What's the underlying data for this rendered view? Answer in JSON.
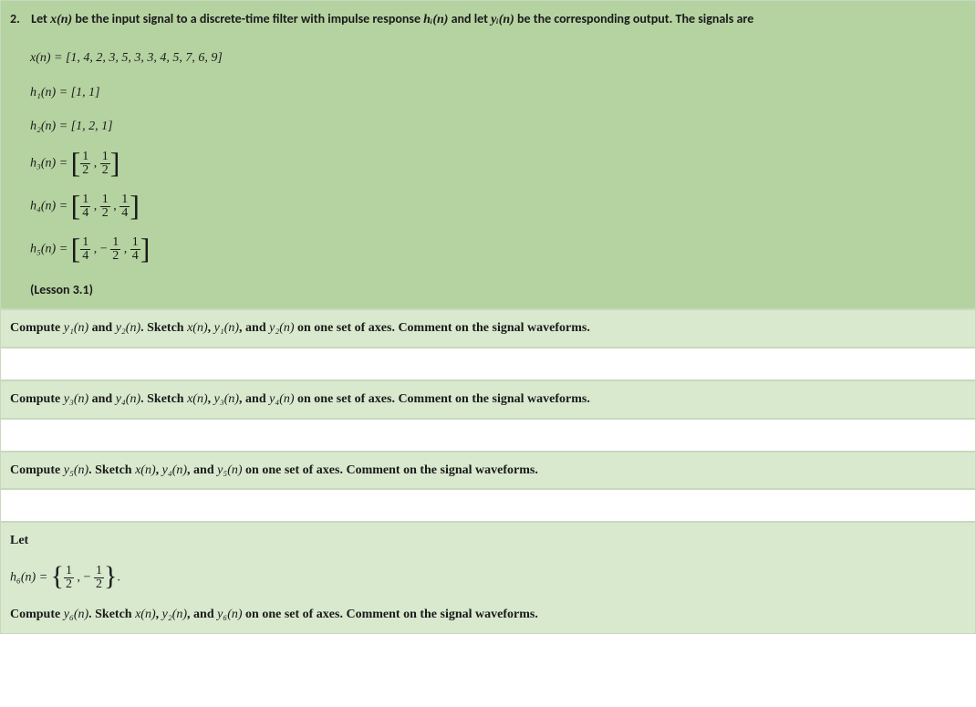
{
  "problem": {
    "number": "2.",
    "intro_part1": "Let ",
    "xn": "x(n)",
    "intro_part2": " be the input signal to a discrete-time filter with impulse response ",
    "hin": "hᵢ(n)",
    "intro_part3": " and let ",
    "yin": "yᵢ(n)",
    "intro_part4": " be the corresponding output. The signals are",
    "eq_xn": "x(n) = [1, 4, 2, 3, 5, 3, 3, 4, 5, 7, 6, 9]",
    "eq_h1": "h₁(n) = [1, 1]",
    "eq_h2": "h₂(n) = [1, 2, 1]",
    "h3_lhs": "h₃(n) = ",
    "h3_f1n": "1",
    "h3_f1d": "2",
    "h3_f2n": "1",
    "h3_f2d": "2",
    "h4_lhs": "h₄(n) = ",
    "h4_f1n": "1",
    "h4_f1d": "4",
    "h4_f2n": "1",
    "h4_f2d": "2",
    "h4_f3n": "1",
    "h4_f3d": "4",
    "h5_lhs": "h₅(n) = ",
    "h5_f1n": "1",
    "h5_f1d": "4",
    "h5_f2n": "1",
    "h5_f2d": "2",
    "h5_f3n": "1",
    "h5_f3d": "4",
    "lesson": "(Lesson 3.1)"
  },
  "row_a": {
    "p1": "Compute ",
    "y1": "y₁(n)",
    "p2": " and ",
    "y2": "y₂(n)",
    "p3": ". Sketch ",
    "x": "x(n)",
    "p4": ", ",
    "y1b": "y₁(n)",
    "p5": ", and ",
    "y2b": "y₂(n)",
    "p6": " on one set of axes. Comment on the signal waveforms."
  },
  "row_b": {
    "p1": "Compute ",
    "y3": "y₃(n)",
    "p2": " and ",
    "y4": "y₄(n)",
    "p3": ". Sketch ",
    "x": "x(n)",
    "p4": ", ",
    "y3b": "y₃(n)",
    "p5": ", and ",
    "y4b": "y₄(n)",
    "p6": " on one set of axes. Comment on the signal waveforms."
  },
  "row_c": {
    "p1": "Compute ",
    "y5": "y₅(n)",
    "p2": ". Sketch ",
    "x": "x(n)",
    "p3": ", ",
    "y4": "y₄(n)",
    "p4": ", and ",
    "y5b": "y₅(n)",
    "p5": " on one set of axes. Comment on the signal waveforms."
  },
  "row_d": {
    "let": "Let",
    "h6_lhs": "h₆(n) = ",
    "h6_f1n": "1",
    "h6_f1d": "2",
    "h6_f2n": "1",
    "h6_f2d": "2",
    "dot": ".",
    "p1": "Compute ",
    "y6": "y₆(n)",
    "p2": ". Sketch ",
    "x": "x(n)",
    "p3": ", ",
    "y2": "y₂(n)",
    "p4": ", and ",
    "y6b": "y₆(n)",
    "p5": " on one set of axes. Comment on the signal waveforms."
  }
}
